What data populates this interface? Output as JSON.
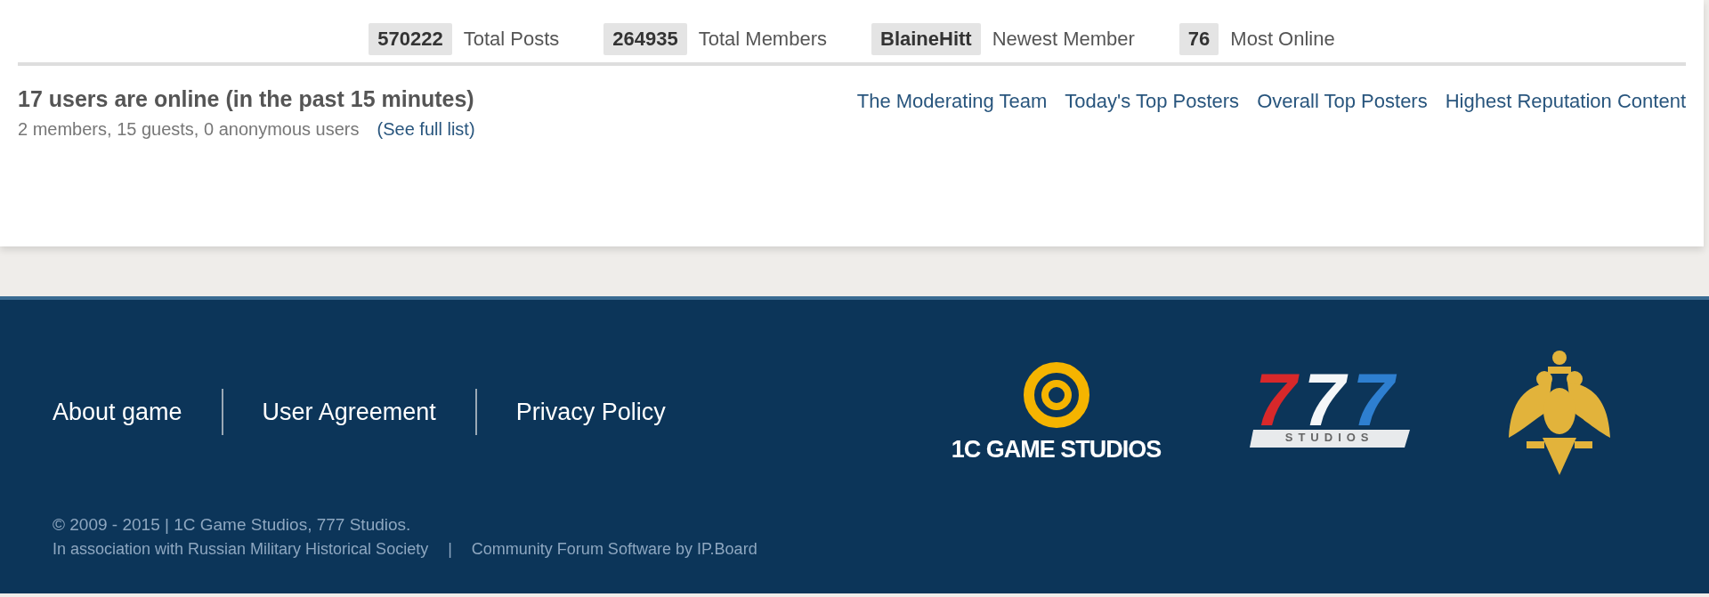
{
  "stats": [
    {
      "value": "570222",
      "label": "Total Posts"
    },
    {
      "value": "264935",
      "label": "Total Members"
    },
    {
      "value": "BlaineHitt",
      "label": "Newest Member"
    },
    {
      "value": "76",
      "label": "Most Online"
    }
  ],
  "online": {
    "title": "17 users are online (in the past 15 minutes)",
    "summary": "2 members, 15 guests, 0 anonymous users",
    "link": "(See full list)"
  },
  "online_links": [
    "The Moderating Team",
    "Today's Top Posters",
    "Overall Top Posters",
    "Highest Reputation Content"
  ],
  "footer": {
    "links": [
      "About game",
      "User Agreement",
      "Privacy Policy"
    ],
    "logos": [
      {
        "kind": "target",
        "text": "1C GAME STUDIOS"
      },
      {
        "kind": "sevens",
        "text": "777",
        "subtext": "STUDIOS"
      },
      {
        "kind": "eagle"
      }
    ],
    "copyright": "© 2009 - 2015 | 1C Game Studios, 777 Studios.",
    "credits": [
      "In association with Russian Military Historical Society",
      "|",
      "Community Forum Software by IP.Board"
    ]
  }
}
